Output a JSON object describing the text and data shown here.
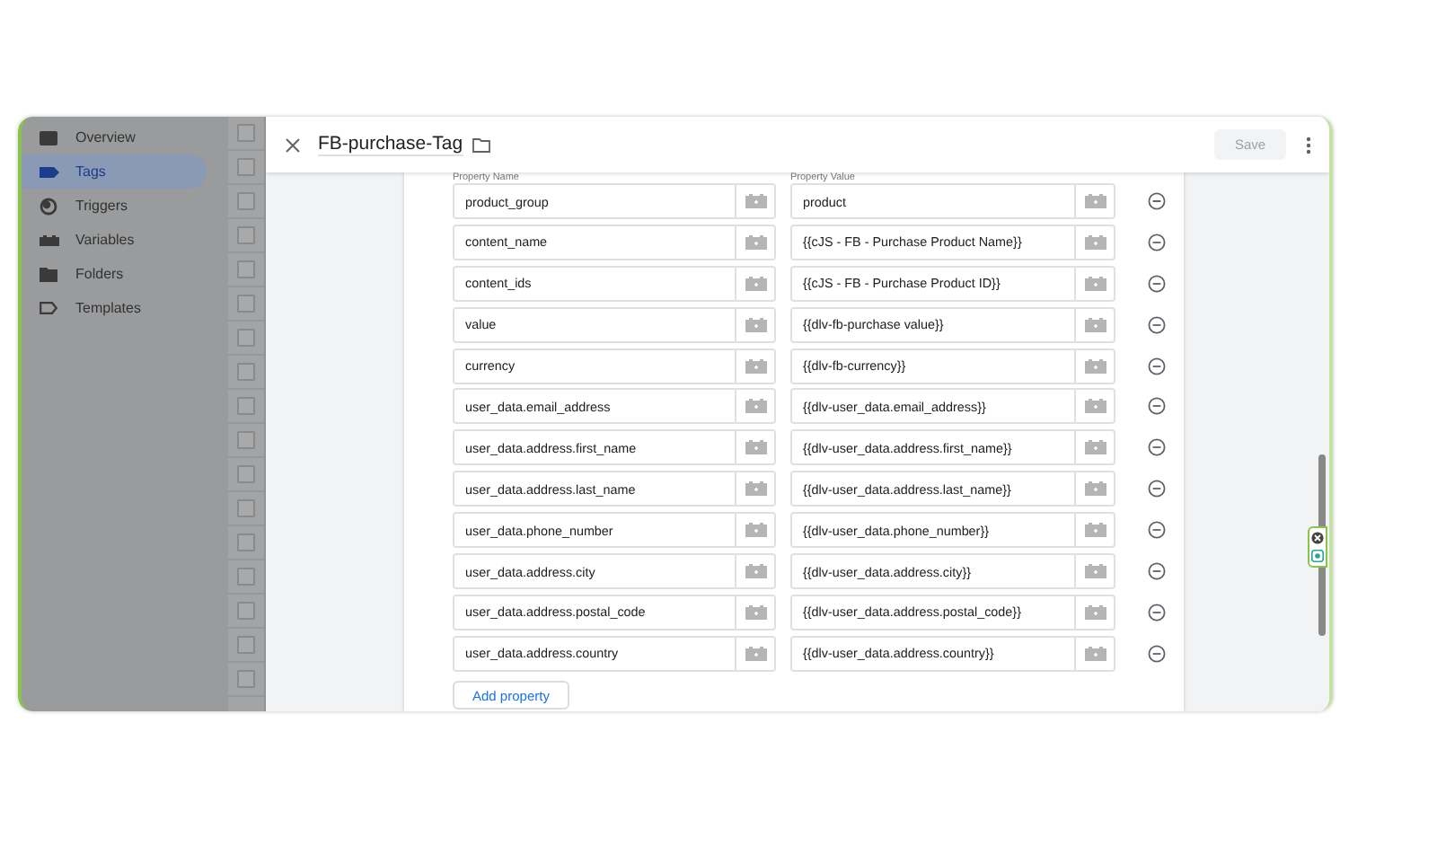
{
  "sidebar": {
    "items": [
      {
        "label": "Overview",
        "selected": false
      },
      {
        "label": "Tags",
        "selected": true
      },
      {
        "label": "Triggers",
        "selected": false
      },
      {
        "label": "Variables",
        "selected": false
      },
      {
        "label": "Folders",
        "selected": false
      },
      {
        "label": "Templates",
        "selected": false
      }
    ]
  },
  "row_checkboxes": [
    {
      "checked": false
    },
    {
      "checked": false
    },
    {
      "checked": false
    },
    {
      "checked": false
    },
    {
      "checked": false
    },
    {
      "checked": false
    },
    {
      "checked": false
    },
    {
      "checked": false
    },
    {
      "checked": false
    },
    {
      "checked": false
    },
    {
      "checked": false
    },
    {
      "checked": false
    },
    {
      "checked": false
    },
    {
      "checked": false
    },
    {
      "checked": false
    },
    {
      "checked": false
    },
    {
      "checked": false
    }
  ],
  "panel": {
    "title": "FB-purchase-Tag",
    "save": "Save",
    "save_disabled": true
  },
  "properties": {
    "name_label": "Property Name",
    "value_label": "Property Value",
    "rows": [
      {
        "name": "product_group",
        "value": "product"
      },
      {
        "name": "content_name",
        "value": "{{cJS - FB - Purchase Product Name}}"
      },
      {
        "name": "content_ids",
        "value": "{{cJS - FB - Purchase Product ID}}"
      },
      {
        "name": "value",
        "value": "{{dlv-fb-purchase value}}"
      },
      {
        "name": "currency",
        "value": "{{dlv-fb-currency}}"
      },
      {
        "name": "user_data.email_address",
        "value": "{{dlv-user_data.email_address}}"
      },
      {
        "name": "user_data.address.first_name",
        "value": "{{dlv-user_data.address.first_name}}"
      },
      {
        "name": "user_data.address.last_name",
        "value": "{{dlv-user_data.address.last_name}}"
      },
      {
        "name": "user_data.phone_number",
        "value": "{{dlv-user_data.phone_number}}"
      },
      {
        "name": "user_data.address.city",
        "value": "{{dlv-user_data.address.city}}"
      },
      {
        "name": "user_data.address.postal_code",
        "value": "{{dlv-user_data.address.postal_code}}"
      },
      {
        "name": "user_data.address.country",
        "value": "{{dlv-user_data.address.country}}"
      }
    ],
    "add_button": "Add property"
  }
}
